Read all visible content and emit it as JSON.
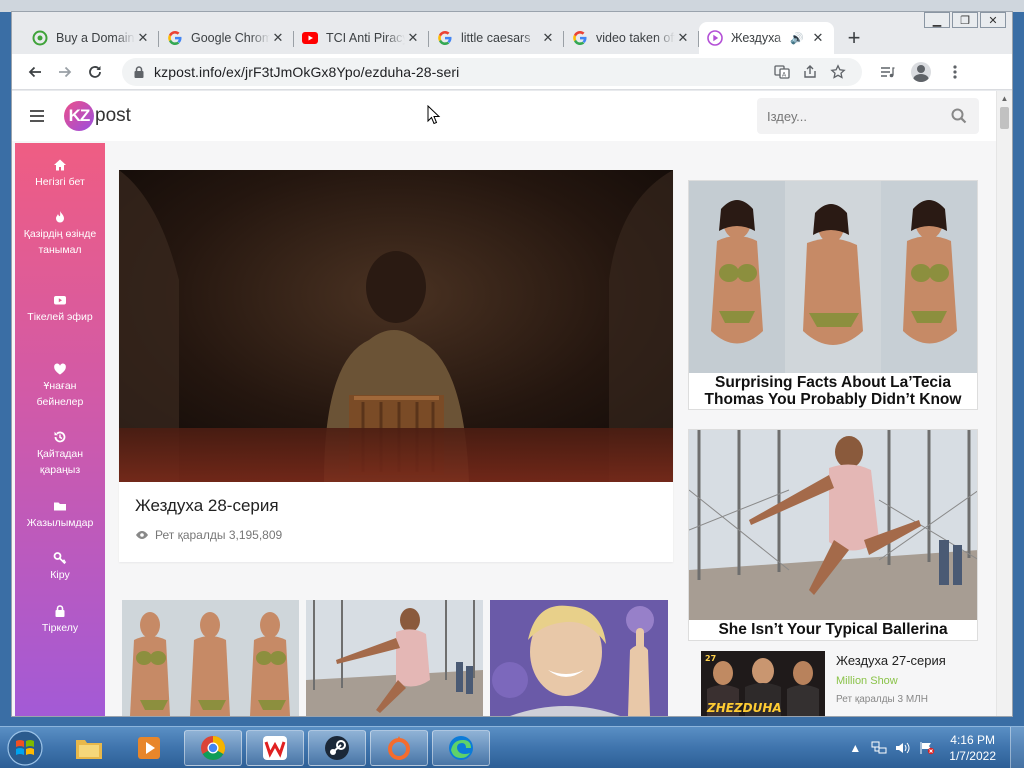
{
  "browser": {
    "tabs": [
      {
        "title": "Buy a Domain",
        "favicon": "domain-site-icon",
        "active": false
      },
      {
        "title": "Google Chrome",
        "favicon": "google-icon",
        "active": false
      },
      {
        "title": "TCI Anti Piracy",
        "favicon": "youtube-icon",
        "active": false
      },
      {
        "title": "little caesars",
        "favicon": "google-icon",
        "active": false
      },
      {
        "title": "video taken off",
        "favicon": "google-icon",
        "active": false
      },
      {
        "title": "Жездуха",
        "favicon": "video-site-icon",
        "active": true,
        "audio": "speaker-icon"
      }
    ],
    "new_tab_label": "+",
    "url": "kzpost.info/ex/jrF3tJmOkGx8Ypo/ezduha-28-seri"
  },
  "site": {
    "logo_badge": "KZ",
    "logo_text": "post",
    "search_placeholder": "Іздеу...",
    "sidebar": [
      {
        "label": "Негізгі бет",
        "icon": "home-icon"
      },
      {
        "label": "Қазірдің өзінде танымал",
        "icon": "flame-icon"
      },
      {
        "label": "Тікелей эфир",
        "icon": "youtube-icon"
      },
      {
        "label": "Ұнаған бейнелер",
        "icon": "heart-icon"
      },
      {
        "label": "Қайтадан қараңыз",
        "icon": "history-icon"
      },
      {
        "label": "Жазылымдар",
        "icon": "folder-icon"
      },
      {
        "label": "Кіру",
        "icon": "key-icon"
      },
      {
        "label": "Тіркелу",
        "icon": "lock-icon"
      }
    ],
    "main_video": {
      "title": "Жездуха 28-серия",
      "views_label": "Рет қаралды 3,195,809"
    },
    "ads": [
      {
        "caption": "Surprising Facts About La’Tecia Thomas You Probably Didn’t Know"
      },
      {
        "caption": "She Isn’t Your Typical Ballerina"
      }
    ],
    "side_video": {
      "title": "Жездуха 27-серия",
      "channel": "Million Show",
      "views": "Рет қаралды 3 МЛН",
      "thumb_badge": "27",
      "thumb_text": "ZHEZDUHA"
    }
  },
  "taskbar": {
    "apps": [
      {
        "name": "file-explorer-icon",
        "open": false
      },
      {
        "name": "media-player-icon",
        "open": false
      },
      {
        "name": "chrome-icon",
        "open": true
      },
      {
        "name": "wps-icon",
        "open": true
      },
      {
        "name": "steam-icon",
        "open": true
      },
      {
        "name": "origin-icon",
        "open": true
      },
      {
        "name": "edge-icon",
        "open": true
      }
    ],
    "time": "4:16 PM",
    "date": "1/7/2022"
  }
}
